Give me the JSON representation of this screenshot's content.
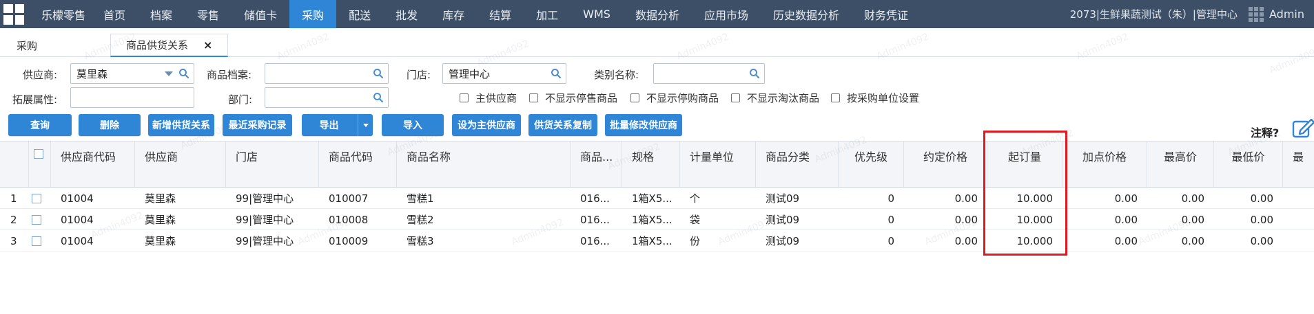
{
  "app": {
    "brand": "乐檬零售",
    "org": "2073|生鲜果蔬测试（朱）|管理中心",
    "user": "Admin",
    "watermark": "Admin4092"
  },
  "nav": [
    {
      "label": "首页",
      "active": false
    },
    {
      "label": "档案",
      "active": false
    },
    {
      "label": "零售",
      "active": false
    },
    {
      "label": "储值卡",
      "active": false
    },
    {
      "label": "采购",
      "active": true
    },
    {
      "label": "配送",
      "active": false
    },
    {
      "label": "批发",
      "active": false
    },
    {
      "label": "库存",
      "active": false
    },
    {
      "label": "结算",
      "active": false
    },
    {
      "label": "加工",
      "active": false
    },
    {
      "label": "WMS",
      "active": false
    },
    {
      "label": "数据分析",
      "active": false
    },
    {
      "label": "应用市场",
      "active": false
    },
    {
      "label": "历史数据分析",
      "active": false
    },
    {
      "label": "财务凭证",
      "active": false
    }
  ],
  "tabs": [
    {
      "label": "采购"
    },
    {
      "label": "商品供货关系",
      "close": "×"
    }
  ],
  "filters": {
    "supplier_label": "供应商:",
    "supplier_value": "莫里森",
    "product_label": "商品档案:",
    "product_value": "",
    "store_label": "门店:",
    "store_value": "管理中心",
    "category_label": "类别名称:",
    "category_value": "",
    "ext_label": "拓展属性:",
    "ext_value": "",
    "dept_label": "部门:",
    "dept_value": "",
    "checkboxes": [
      "主供应商",
      "不显示停售商品",
      "不显示停购商品",
      "不显示淘汰商品",
      "按采购单位设置"
    ]
  },
  "buttons": {
    "query": "查询",
    "delete": "删除",
    "add": "新增供货关系",
    "recent": "最近采购记录",
    "export": "导出",
    "import": "导入",
    "set_main": "设为主供应商",
    "copy": "供货关系复制",
    "batch": "批量修改供应商"
  },
  "note_label": "注释?",
  "table": {
    "columns": [
      "供应商代码",
      "供应商",
      "门店",
      "商品代码",
      "商品名称",
      "商品...",
      "规格",
      "计量单位",
      "商品分类",
      "优先级",
      "约定价格",
      "起订量",
      "加点价格",
      "最高价",
      "最低价",
      "最"
    ],
    "rows": [
      {
        "n": "1",
        "cells": [
          "01004",
          "莫里森",
          "99|管理中心",
          "010007",
          "雪糕1",
          "016...",
          "1箱X5...",
          "个",
          "测试09",
          "0",
          "0.00",
          "10.000",
          "0.00",
          "0.00",
          "0.00"
        ]
      },
      {
        "n": "2",
        "cells": [
          "01004",
          "莫里森",
          "99|管理中心",
          "010008",
          "雪糕2",
          "016...",
          "1箱X5...",
          "袋",
          "测试09",
          "0",
          "0.00",
          "10.000",
          "0.00",
          "0.00",
          "0.00"
        ]
      },
      {
        "n": "3",
        "cells": [
          "01004",
          "莫里森",
          "99|管理中心",
          "010009",
          "雪糕3",
          "016...",
          "1箱X5...",
          "份",
          "测试09",
          "0",
          "0.00",
          "10.000",
          "0.00",
          "0.00",
          "0.00"
        ]
      }
    ]
  },
  "colors": {
    "nav_bg": "#3d4f66",
    "accent": "#2f86d6",
    "highlight": "#e0191f"
  }
}
